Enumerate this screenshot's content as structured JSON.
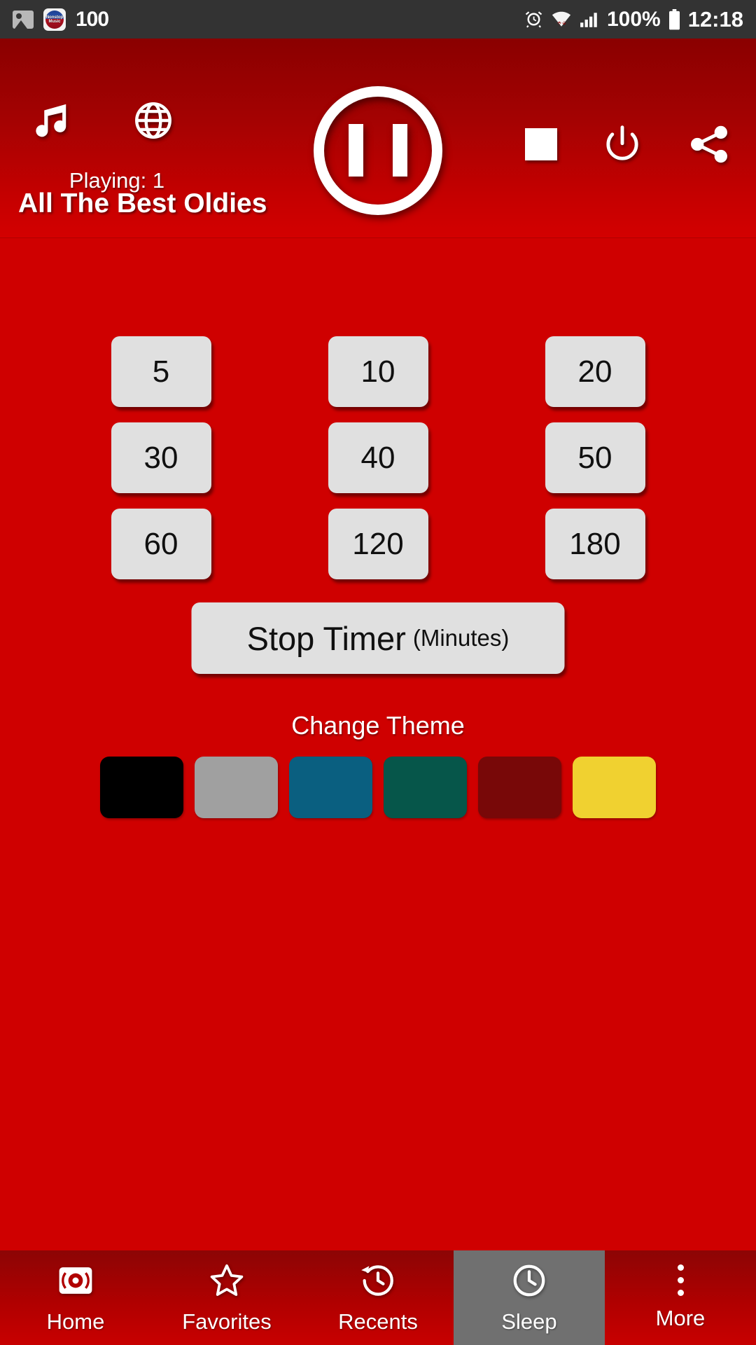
{
  "statusbar": {
    "image_icon": "image-icon",
    "app_icon": "nonstop-music-app-icon",
    "app_icon_line1": "Nonstop",
    "app_icon_line2": "Music",
    "notif_count": "100",
    "alarm_icon": "alarm-icon",
    "wifi_icon": "wifi-icon",
    "signal_icon": "signal-icon",
    "battery_percent": "100%",
    "battery_icon": "battery-icon",
    "time": "12:18"
  },
  "header": {
    "music_icon": "music-note-icon",
    "globe_icon": "globe-icon",
    "playing_label": "Playing: 1",
    "pause_button": "pause-button",
    "stop_button": "stop-button",
    "power_button": "power-button",
    "share_button": "share-button",
    "station_title": "All The Best Oldies"
  },
  "main": {
    "timer_buttons": [
      "5",
      "10",
      "20",
      "30",
      "40",
      "50",
      "60",
      "120",
      "180"
    ],
    "stop_timer_label": "Stop Timer",
    "stop_timer_unit": "(Minutes)",
    "change_theme_label": "Change Theme",
    "themes": [
      {
        "name": "black",
        "color": "#000000"
      },
      {
        "name": "gray",
        "color": "#a0a0a0"
      },
      {
        "name": "teal-blue",
        "color": "#0a5f80"
      },
      {
        "name": "green",
        "color": "#06564a"
      },
      {
        "name": "dark-red",
        "color": "#780808"
      },
      {
        "name": "yellow",
        "color": "#f0d130"
      }
    ]
  },
  "bottomnav": {
    "items": [
      {
        "label": "Home",
        "icon": "radio-icon",
        "active": false
      },
      {
        "label": "Favorites",
        "icon": "star-icon",
        "active": false
      },
      {
        "label": "Recents",
        "icon": "history-icon",
        "active": false
      },
      {
        "label": "Sleep",
        "icon": "clock-icon",
        "active": true
      },
      {
        "label": "More",
        "icon": "more-vert-icon",
        "active": false
      }
    ]
  },
  "colors": {
    "background": "#cf0000",
    "header_top": "#8a0000",
    "header_bottom": "#d30000",
    "statusbar": "#333333",
    "button_face": "#e0e0e0",
    "active_tab": "#707070"
  }
}
